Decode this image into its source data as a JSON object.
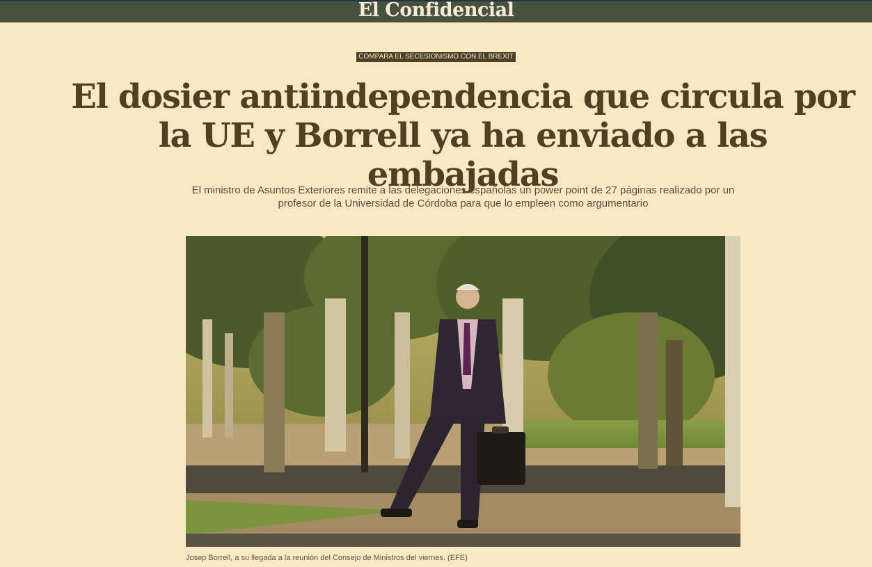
{
  "header": {
    "logo_text": "El Confidencial",
    "background_color": "#475140"
  },
  "article": {
    "kicker": "COMPARA EL SECESIONISMO CON EL BREXIT",
    "headline": "El dosier antiindependencia que circula por la UE y Borrell ya ha enviado a las embajadas",
    "subtitle": "El ministro de Asuntos Exteriores remite a las delegaciones españolas un power point de 27 páginas realizado por un profesor de la Universidad de Córdoba para que lo empleen como argumentario",
    "image_caption": "Josep Borrell, a su llegada a la reunión del Consejo de Ministros del viernes. (EFE)"
  },
  "theme": {
    "page_background": "#f9e8c4",
    "headline_color": "#503f20",
    "kicker_background": "#4a4129"
  }
}
